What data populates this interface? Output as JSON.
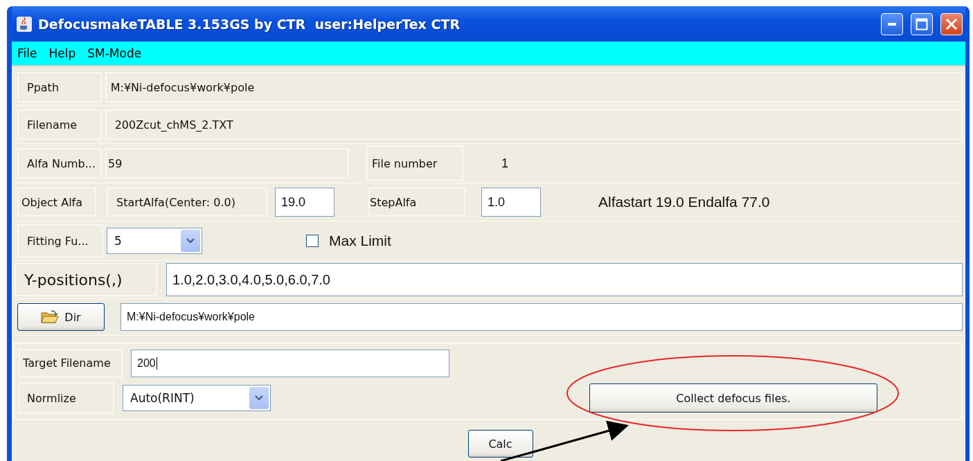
{
  "window": {
    "title": "DefocusmakeTABLE 3.153GS by CTR  user:HelperTex CTR"
  },
  "menu": [
    {
      "label": "File"
    },
    {
      "label": "Help"
    },
    {
      "label": "SM-Mode"
    }
  ],
  "ppath": {
    "label": "Ppath",
    "value": "M:¥Ni-defocus¥work¥pole"
  },
  "filename": {
    "label": "Filename",
    "value": "200Zcut_chMS_2.TXT"
  },
  "alfa_number": {
    "label": "Alfa Numb...",
    "value": "59"
  },
  "file_number": {
    "label": "File number",
    "value": "1"
  },
  "object_alfa": {
    "label": "Object Alfa",
    "start_label": "StartAlfa(Center: 0.0)",
    "start_value": "19.0",
    "step_label": "StepAlfa",
    "step_value": "1.0",
    "summary": "Alfastart 19.0 Endalfa 77.0"
  },
  "fitting": {
    "label": "Fitting Fu...",
    "value": "5"
  },
  "max_limit": {
    "label": "Max Limit",
    "checked": false
  },
  "y_positions": {
    "label": "Y-positions(,)",
    "value": "1.0,2.0,3.0,4.0,5.0,6.0,7.0"
  },
  "dir": {
    "button": "Dir",
    "value": "M:¥Ni-defocus¥work¥pole"
  },
  "target_filename": {
    "label": "Target Filename",
    "value": "200",
    "focused": true
  },
  "normalize": {
    "label": "Normlize",
    "value": "Auto(RINT)"
  },
  "collect_button": {
    "label": "Collect defocus files."
  },
  "calc_button": {
    "label": "Calc"
  }
}
